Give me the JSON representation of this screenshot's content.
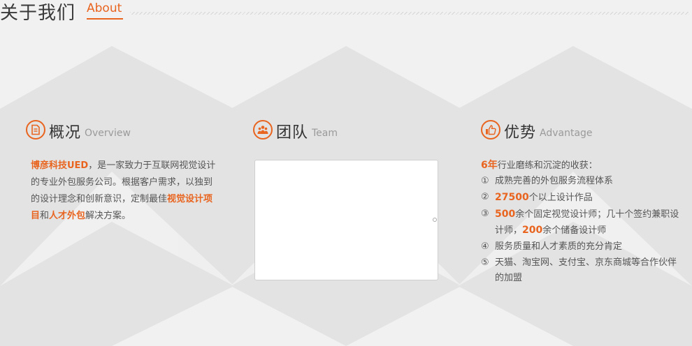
{
  "header": {
    "title_cn": "关于我们",
    "title_en": "About"
  },
  "colors": {
    "accent": "#e8641f",
    "diamond": "#e3e3e3",
    "text": "#555555"
  },
  "overview": {
    "title_cn": "概况",
    "title_en": "Overview",
    "icon": "document-icon",
    "highlight_company": "博彦科技UED",
    "text_1": "，是一家致力于互联网视觉设计的专业外包服务公司。根据客户需求，以独到的设计理念和创新意识，定制最佳",
    "highlight_design": "视觉设计项目",
    "text_2": "和",
    "highlight_talent": "人才外包",
    "text_3": "解决方案。"
  },
  "team": {
    "title_cn": "团队",
    "title_en": "Team",
    "icon": "team-icon"
  },
  "advantage": {
    "title_cn": "优势",
    "title_en": "Advantage",
    "icon": "thumbs-up-icon",
    "intro_years": "6年",
    "intro_text": "行业磨练和沉淀的收获：",
    "items": [
      {
        "num": "①",
        "text": "成熟完善的外包服务流程体系"
      },
      {
        "num": "②",
        "hl": "27500",
        "text": "个以上设计作品"
      },
      {
        "num": "③",
        "hl": "500",
        "text": "余个固定视觉设计师；几十个签约兼职设计师，",
        "hl2": "200",
        "text2": "余个储备设计师"
      },
      {
        "num": "④",
        "text": "服务质量和人才素质的充分肯定"
      },
      {
        "num": "⑤",
        "text": "天猫、淘宝网、支付宝、京东商城等合作伙伴的加盟"
      }
    ]
  }
}
